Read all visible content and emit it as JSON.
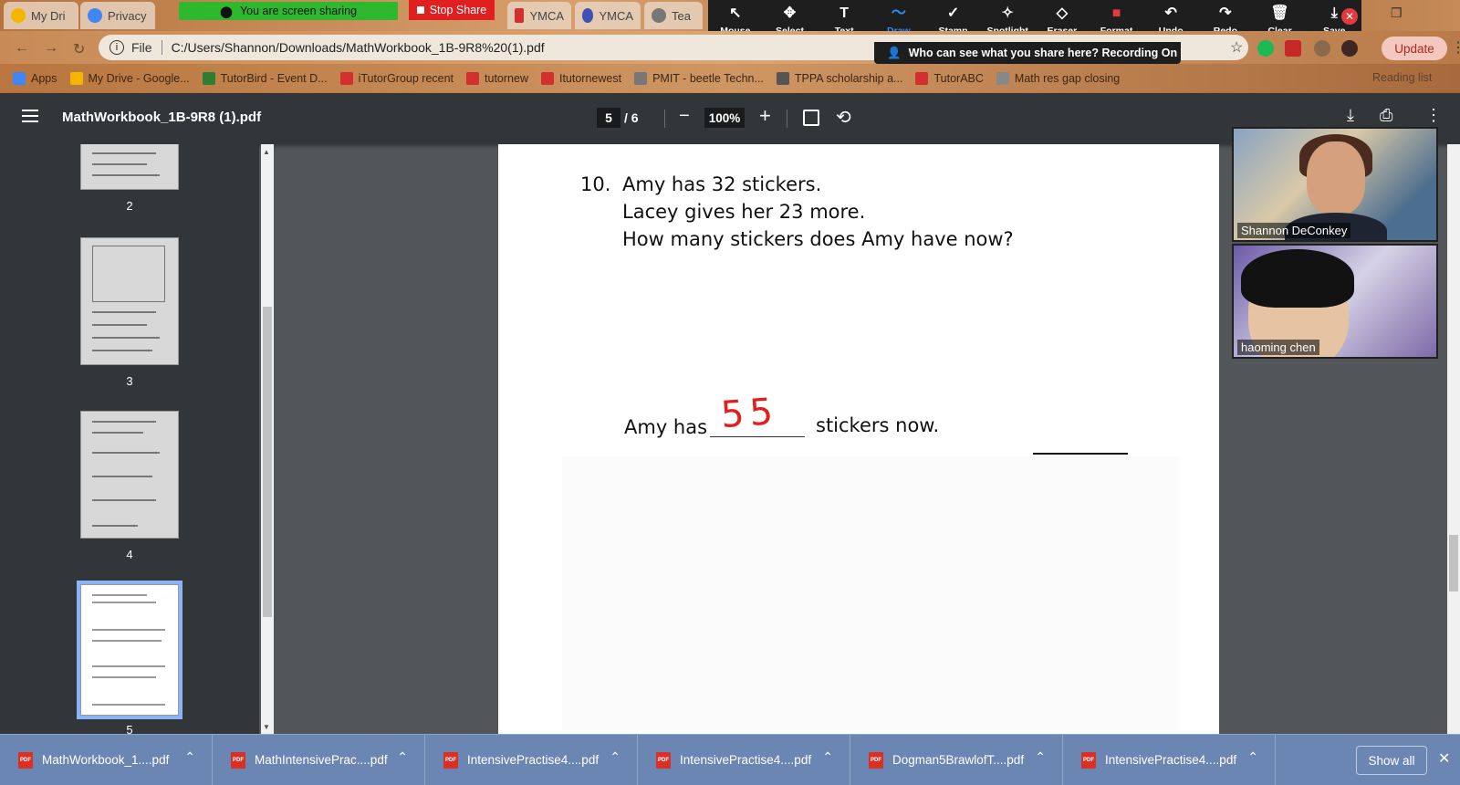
{
  "tabs": [
    {
      "label": "My Dri"
    },
    {
      "label": "Privacy"
    },
    {
      "label": "YMCA"
    },
    {
      "label": "YMCA"
    },
    {
      "label": "Tea"
    }
  ],
  "zoom_share": {
    "sharing_text": "You are screen sharing",
    "stop_label": "Stop Share",
    "tools": [
      {
        "glyph": "↖",
        "label": "Mouse"
      },
      {
        "glyph": "✥",
        "label": "Select"
      },
      {
        "glyph": "T",
        "label": "Text"
      },
      {
        "glyph": "〜",
        "label": "Draw"
      },
      {
        "glyph": "✓",
        "label": "Stamp"
      },
      {
        "glyph": "✧",
        "label": "Spotlight"
      },
      {
        "glyph": "◇",
        "label": "Eraser"
      },
      {
        "glyph": "■",
        "label": "Format"
      },
      {
        "glyph": "↶",
        "label": "Undo"
      },
      {
        "glyph": "↷",
        "label": "Redo"
      },
      {
        "glyph": "🗑",
        "label": "Clear"
      },
      {
        "glyph": "⤓",
        "label": "Save"
      }
    ],
    "active_tool": "Draw",
    "recording_text": "Who can see what you share here? Recording On"
  },
  "browser": {
    "address_prefix": "File",
    "url": "C:/Users/Shannon/Downloads/MathWorkbook_1B-9R8%20(1).pdf",
    "update_label": "Update",
    "reading_list": "Reading list",
    "bookmarks": [
      {
        "label": "Apps",
        "color": "#4285f4"
      },
      {
        "label": "My Drive - Google...",
        "color": "#f4b400"
      },
      {
        "label": "TutorBird - Event D...",
        "color": "#2e7d32"
      },
      {
        "label": "iTutorGroup recent",
        "color": "#d32f2f"
      },
      {
        "label": "tutornew",
        "color": "#d32f2f"
      },
      {
        "label": "Itutornewest",
        "color": "#d32f2f"
      },
      {
        "label": "PMIT - beetle Techn...",
        "color": "#777777"
      },
      {
        "label": "TPPA scholarship a...",
        "color": "#555555"
      },
      {
        "label": "TutorABC",
        "color": "#d32f2f"
      },
      {
        "label": "Math res gap closing",
        "color": "#888888"
      }
    ]
  },
  "pdf": {
    "title": "MathWorkbook_1B-9R8 (1).pdf",
    "current_page": "5",
    "total_pages": "/ 6",
    "zoom": "100%",
    "thumbnails": [
      {
        "label": "2"
      },
      {
        "label": "3"
      },
      {
        "label": "4"
      },
      {
        "label": "5"
      }
    ]
  },
  "worksheet": {
    "number": "10.",
    "line1": "Amy has 32 stickers.",
    "line2": "Lacey gives her 23 more.",
    "line3": "How many stickers does Amy have now?",
    "answer_prefix": "Amy has",
    "answer_suffix": "stickers now.",
    "handwritten_answer": "55"
  },
  "participants": [
    {
      "name": "Shannon DeConkey"
    },
    {
      "name": "haoming   chen"
    }
  ],
  "downloads": {
    "items": [
      {
        "label": "MathWorkbook_1....pdf"
      },
      {
        "label": "MathIntensivePrac....pdf"
      },
      {
        "label": "IntensivePractise4....pdf"
      },
      {
        "label": "IntensivePractise4....pdf"
      },
      {
        "label": "Dogman5BrawlofT....pdf"
      },
      {
        "label": "IntensivePractise4....pdf"
      }
    ],
    "show_all": "Show all"
  }
}
